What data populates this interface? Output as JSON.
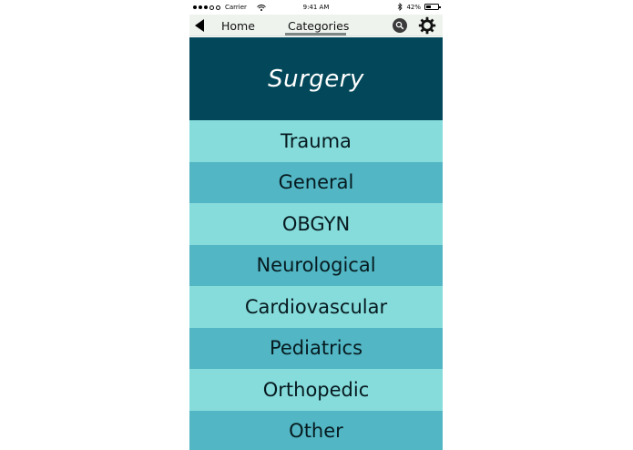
{
  "status_bar": {
    "carrier": "Carrier",
    "time": "9:41 AM",
    "battery_percent": "42%",
    "battery_level": 0.42,
    "signal_bars_filled": 3,
    "signal_bars_total": 5
  },
  "nav": {
    "home_label": "Home",
    "categories_label": "Categories",
    "back_icon": "back-arrow-icon",
    "search_icon": "search-icon",
    "settings_icon": "gear-icon"
  },
  "header": {
    "title": "Surgery"
  },
  "categories": [
    "Trauma",
    "General",
    "OBGYN",
    "Neurological",
    "Cardiovascular",
    "Pediatrics",
    "Orthopedic",
    "Other"
  ],
  "colors": {
    "header_bg": "#03485a",
    "row_light": "#86dbdb",
    "row_dark": "#52b6c4",
    "nav_bg": "#eef3ee"
  }
}
